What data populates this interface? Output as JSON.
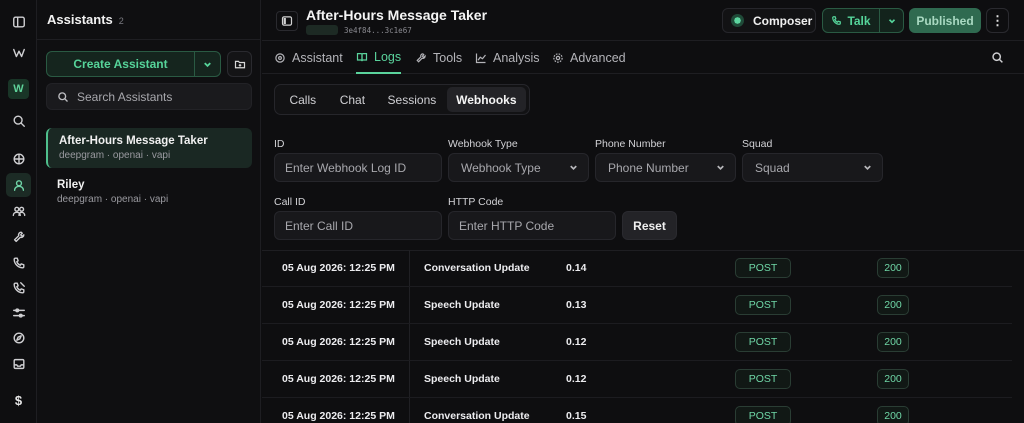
{
  "sidebar": {
    "title": "Assistants",
    "count": "2",
    "create_label": "Create Assistant",
    "search_placeholder": "Search Assistants",
    "assistants": [
      {
        "name": "After-Hours Message Taker",
        "meta": "deepgram · openai · vapi"
      },
      {
        "name": "Riley",
        "meta": "deepgram · openai · vapi"
      }
    ]
  },
  "rail": {
    "workspace_badge": "W",
    "dollar": "$"
  },
  "header": {
    "title": "After-Hours Message Taker",
    "id": "3e4f84...3c1e67",
    "composer_label": "Composer",
    "talk_label": "Talk",
    "published_label": "Published",
    "more": "⋮"
  },
  "tabs": [
    {
      "label": "Assistant",
      "icon": "assistant-icon"
    },
    {
      "label": "Logs",
      "icon": "book-icon"
    },
    {
      "label": "Tools",
      "icon": "wrench-icon"
    },
    {
      "label": "Analysis",
      "icon": "chart-icon"
    },
    {
      "label": "Advanced",
      "icon": "gear-icon"
    }
  ],
  "subtabs": [
    "Calls",
    "Chat",
    "Sessions",
    "Webhooks"
  ],
  "filters": {
    "id_label": "ID",
    "id_placeholder": "Enter Webhook Log ID",
    "type_label": "Webhook Type",
    "type_value": "Webhook Type",
    "phone_label": "Phone Number",
    "phone_value": "Phone Number",
    "squad_label": "Squad",
    "squad_value": "Squad",
    "call_label": "Call ID",
    "call_placeholder": "Enter Call ID",
    "http_label": "HTTP Code",
    "http_placeholder": "Enter HTTP Code",
    "reset_label": "Reset"
  },
  "logs": [
    {
      "time": "05 Aug 2026: 12:25 PM",
      "type": "Conversation Update",
      "duration": "0.14",
      "method": "POST",
      "code": "200"
    },
    {
      "time": "05 Aug 2026: 12:25 PM",
      "type": "Speech Update",
      "duration": "0.13",
      "method": "POST",
      "code": "200"
    },
    {
      "time": "05 Aug 2026: 12:25 PM",
      "type": "Speech Update",
      "duration": "0.12",
      "method": "POST",
      "code": "200"
    },
    {
      "time": "05 Aug 2026: 12:25 PM",
      "type": "Speech Update",
      "duration": "0.12",
      "method": "POST",
      "code": "200"
    },
    {
      "time": "05 Aug 2026: 12:25 PM",
      "type": "Conversation Update",
      "duration": "0.15",
      "method": "POST",
      "code": "200"
    }
  ],
  "colors": {
    "accent": "#5ad39c",
    "background": "#0e0e10"
  }
}
